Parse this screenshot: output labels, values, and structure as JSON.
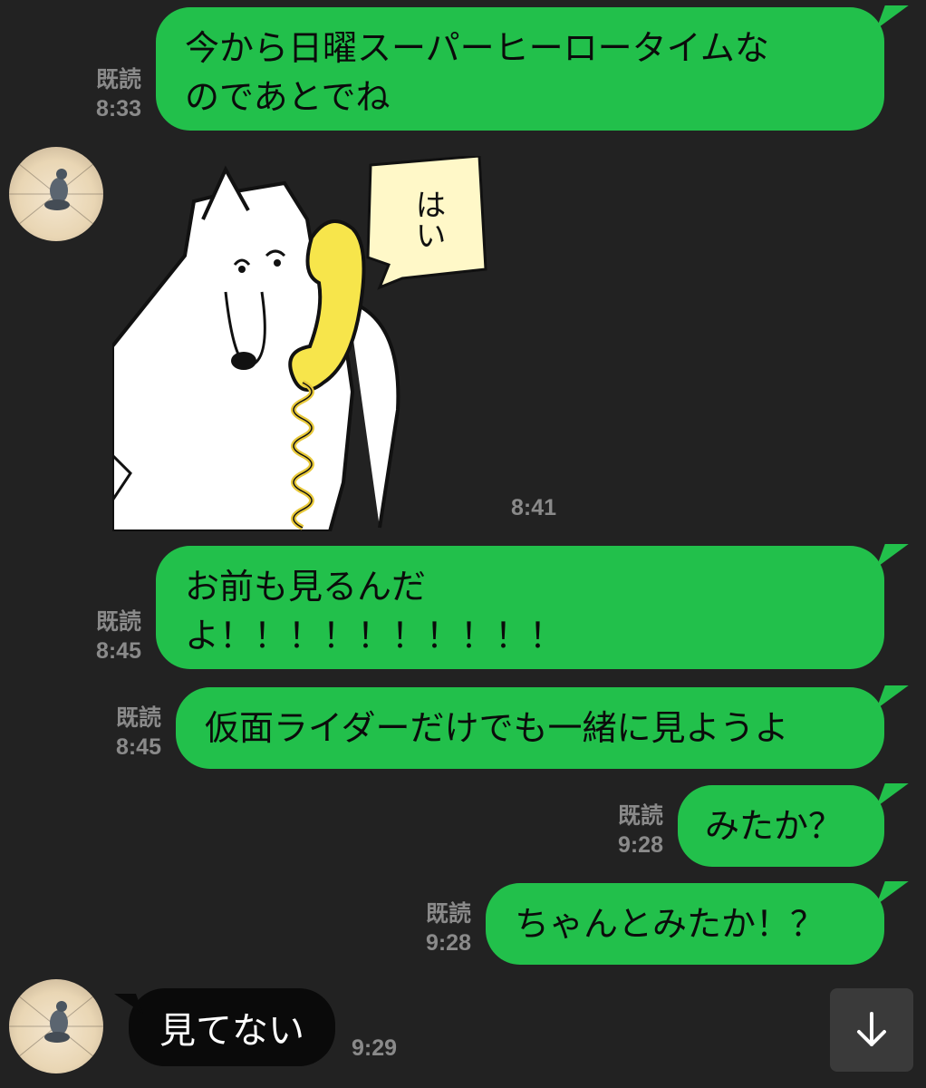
{
  "messages": [
    {
      "text_line1": "今から日曜スーパーヒーロータイムな",
      "text_line2": "のであとでね",
      "read": "既読",
      "time": "8:33"
    },
    {
      "sticker_text": "はい",
      "time": "8:41"
    },
    {
      "text_line1": "お前も見るんだ",
      "text_line2": "よ！！！！！！！！！！",
      "read": "既読",
      "time": "8:45"
    },
    {
      "text": "仮面ライダーだけでも一緒に見ようよ",
      "read": "既読",
      "time": "8:45"
    },
    {
      "text": "みたか？",
      "read": "既読",
      "time": "9:28"
    },
    {
      "text": "ちゃんとみたか！？",
      "read": "既読",
      "time": "9:28"
    },
    {
      "text": "見てない",
      "time": "9:29"
    }
  ],
  "colors": {
    "background": "#222222",
    "outgoing": "#22c04b",
    "incoming": "#0a0a0a",
    "meta": "#8a8a8a"
  },
  "icons": {
    "scroll": "arrow-down-icon",
    "avatar": "pigeon-avatar"
  }
}
